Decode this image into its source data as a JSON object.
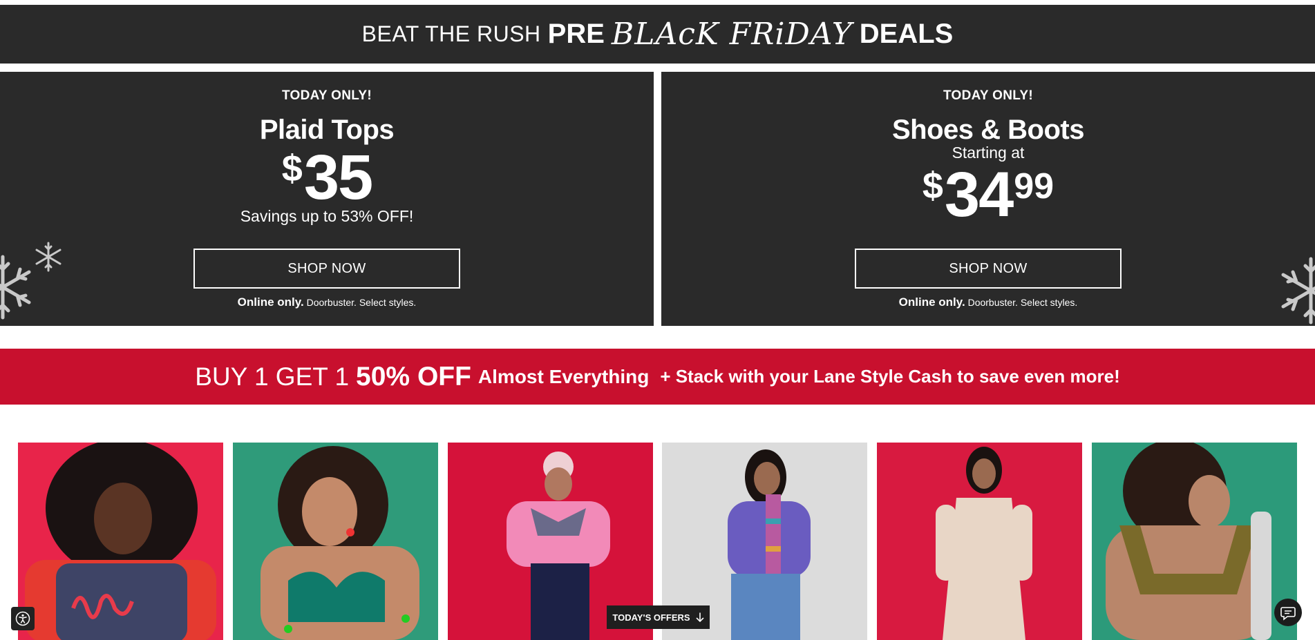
{
  "top_banner": {
    "prefix": "BEAT THE RUSH",
    "pre": "PRE",
    "script": "BLAcK FRiDAY",
    "suffix": "DEALS"
  },
  "promos": [
    {
      "eyebrow": "TODAY ONLY!",
      "headline": "Plaid Tops",
      "currency": "$",
      "price": "35",
      "savings": "Savings up to 53% OFF!",
      "button": "SHOP NOW",
      "fine_bold": "Online only.",
      "fine_rest": "Doorbuster. Select styles."
    },
    {
      "eyebrow": "TODAY ONLY!",
      "headline": "Shoes & Boots",
      "subline": "Starting at",
      "currency": "$",
      "price": "34",
      "cents": "99",
      "button": "SHOP NOW",
      "fine_bold": "Online only.",
      "fine_rest": "Doorbuster. Select styles."
    }
  ],
  "bogo": {
    "lead": "BUY 1 GET 1",
    "offer": "50% OFF",
    "scope": "Almost Everything",
    "stack": "+ Stack with your Lane Style Cash to save even more!"
  },
  "floating": {
    "offers_label": "TODAY'S OFFERS"
  },
  "icons": [
    "snowflake-icon",
    "accessibility-icon",
    "arrow-down-icon",
    "chat-icon"
  ],
  "colors": {
    "panel": "#2a2a2a",
    "bogo_red": "#c8102e",
    "tile_backgrounds": [
      "#e8244a",
      "#2f9b7a",
      "#d5123a",
      "#dcdcdc",
      "#d81a40",
      "#2c9a7a"
    ]
  }
}
